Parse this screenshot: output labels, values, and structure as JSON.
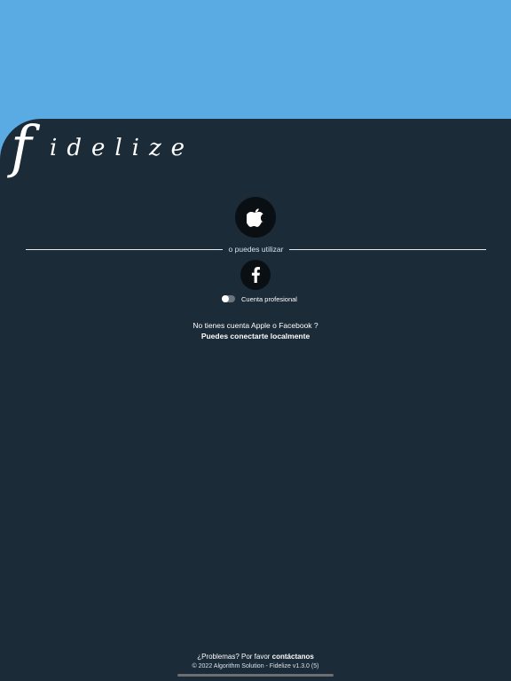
{
  "brand": {
    "logo_initial": "f",
    "logo_rest": "idelize",
    "header_color": "#5aabe4",
    "background_color": "#1b2b38"
  },
  "login": {
    "apple_icon": "apple-logo-icon",
    "divider_text": "o puedes utilizar",
    "facebook_icon": "facebook-logo-icon",
    "pro_account_label": "Cuenta profesional",
    "pro_account_enabled": false,
    "no_account_text": "No tienes cuenta Apple o Facebook ?",
    "local_login_link": "Puedes conectarte localmente"
  },
  "footer": {
    "problems_text": "¿Problemas? Por favor ",
    "contact_link": "contáctanos",
    "copyright": "© 2022 Algorithm Solution - Fidelize v1.3.0 (5)"
  }
}
